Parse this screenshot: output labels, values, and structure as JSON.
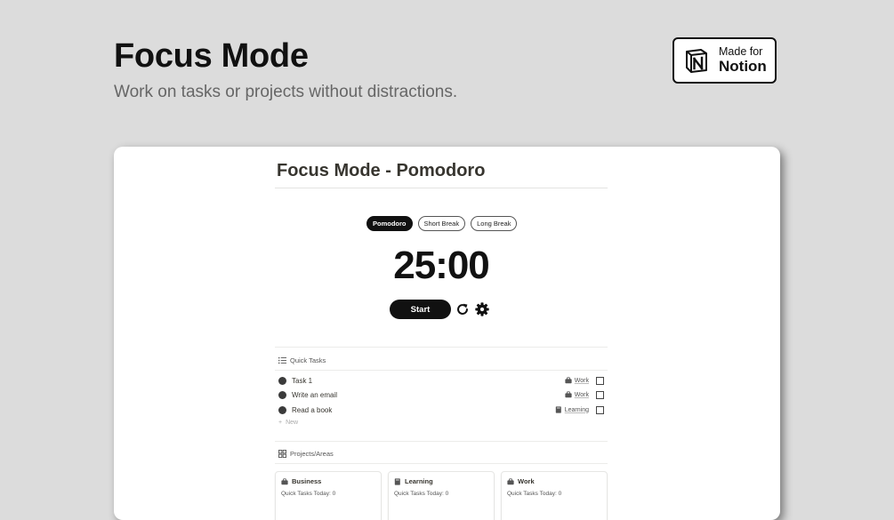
{
  "hero": {
    "title": "Focus Mode",
    "subtitle": "Work on tasks or projects without distractions."
  },
  "badge": {
    "line1": "Made for",
    "line2": "Notion",
    "logo_icon": "notion-logo-icon"
  },
  "page": {
    "title": "Focus Mode - Pomodoro"
  },
  "timer": {
    "tabs": [
      {
        "label": "Pomodoro",
        "active": true
      },
      {
        "label": "Short Break",
        "active": false
      },
      {
        "label": "Long Break",
        "active": false
      }
    ],
    "time": "25:00",
    "start_label": "Start",
    "reset_icon": "refresh-icon",
    "settings_icon": "gear-icon"
  },
  "quick_tasks": {
    "heading": "Quick Tasks",
    "heading_icon": "list-icon",
    "rows": [
      {
        "name": "Task 1",
        "tag": "Work",
        "tag_icon": "briefcase-icon",
        "checked": false
      },
      {
        "name": "Write an email",
        "tag": "Work",
        "tag_icon": "briefcase-icon",
        "checked": false
      },
      {
        "name": "Read a book",
        "tag": "Learning",
        "tag_icon": "book-icon",
        "checked": false
      }
    ],
    "new_label": "New"
  },
  "projects": {
    "heading": "Projects/Areas",
    "heading_icon": "gallery-icon",
    "cards": [
      {
        "name": "Business",
        "icon": "briefcase-icon",
        "sub": "Quick Tasks Today: 0"
      },
      {
        "name": "Learning",
        "icon": "book-icon",
        "sub": "Quick Tasks Today: 0"
      },
      {
        "name": "Work",
        "icon": "briefcase-icon",
        "sub": "Quick Tasks Today: 0"
      }
    ]
  },
  "colors": {
    "background": "#dcdcdc",
    "accent": "#111111",
    "text": "#37352f"
  }
}
